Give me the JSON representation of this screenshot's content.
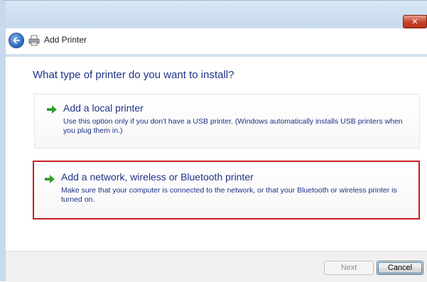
{
  "window": {
    "title": "Add Printer",
    "close_symbol": "✕"
  },
  "header": {
    "back_icon": "back-arrow-icon",
    "printer_icon": "printer-icon",
    "title": "Add Printer"
  },
  "main": {
    "question": "What type of printer do you want to install?",
    "options": [
      {
        "title": "Add a local printer",
        "description": "Use this option only if you don't have a USB printer. (Windows automatically installs USB printers when you plug them in.)",
        "icon": "green-arrow-icon",
        "selected": false
      },
      {
        "title": "Add a network, wireless or Bluetooth printer",
        "description": "Make sure that your computer is connected to the network, or that your Bluetooth or wireless printer is turned on.",
        "icon": "green-arrow-icon",
        "selected": true
      }
    ]
  },
  "footer": {
    "next_label": "Next",
    "cancel_label": "Cancel"
  },
  "colors": {
    "heading": "#1e3287",
    "highlight_border": "#c41e1e",
    "arrow_green": "#2f9a2a"
  }
}
